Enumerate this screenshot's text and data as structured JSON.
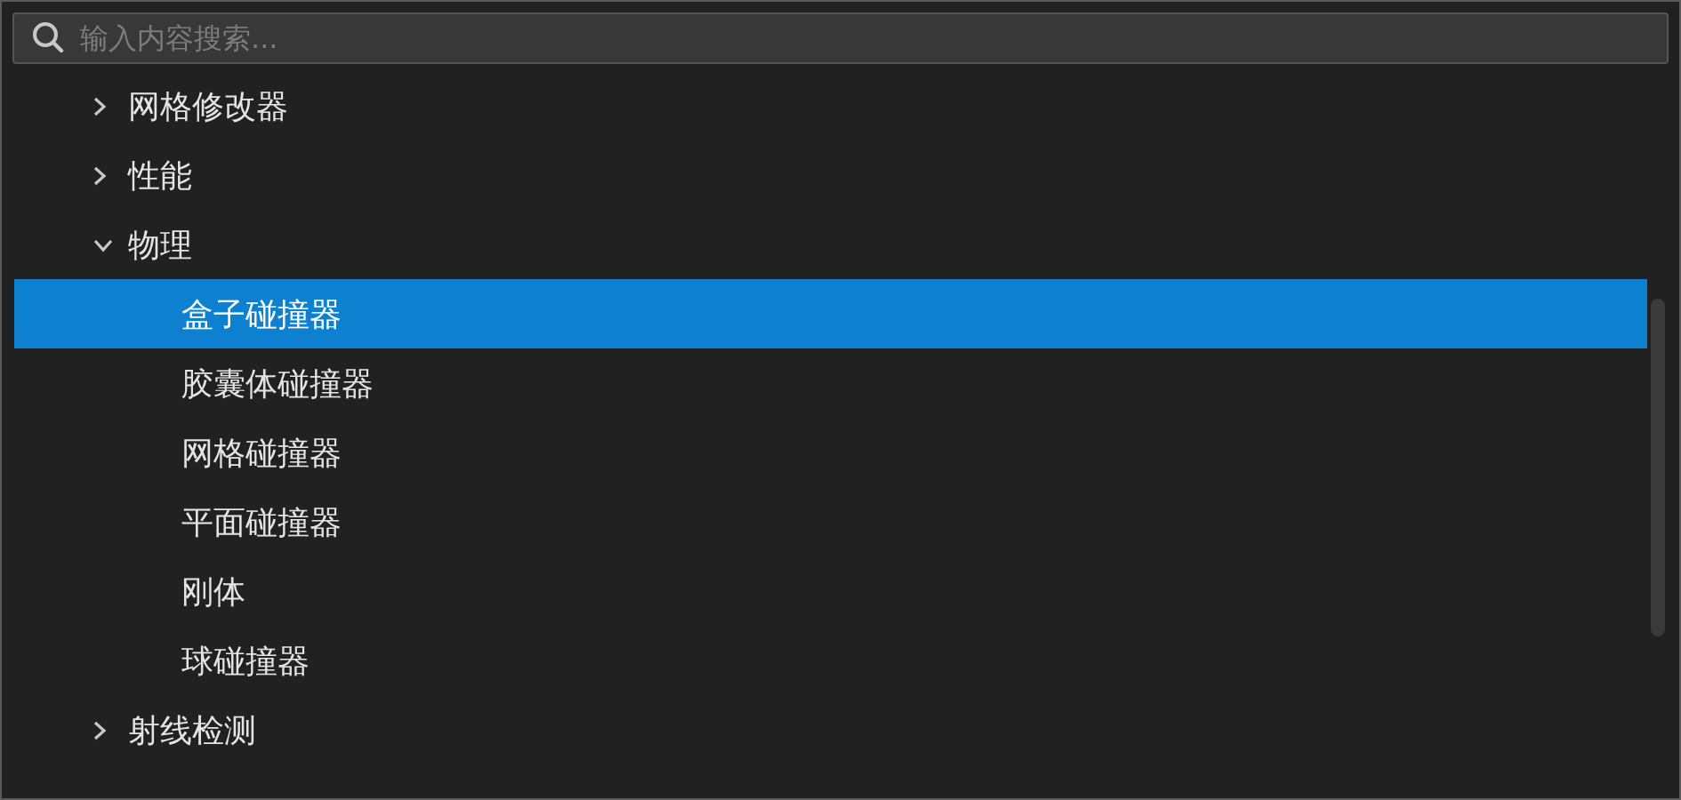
{
  "search": {
    "placeholder": "输入内容搜索..."
  },
  "tree": [
    {
      "label": "网格修改器",
      "expanded": false,
      "selected": false
    },
    {
      "label": "性能",
      "expanded": false,
      "selected": false
    },
    {
      "label": "物理",
      "expanded": true,
      "selected": false,
      "children": [
        {
          "label": "盒子碰撞器",
          "selected": true
        },
        {
          "label": "胶囊体碰撞器",
          "selected": false
        },
        {
          "label": "网格碰撞器",
          "selected": false
        },
        {
          "label": "平面碰撞器",
          "selected": false
        },
        {
          "label": "刚体",
          "selected": false
        },
        {
          "label": "球碰撞器",
          "selected": false
        }
      ]
    },
    {
      "label": "射线检测",
      "expanded": false,
      "selected": false
    }
  ]
}
